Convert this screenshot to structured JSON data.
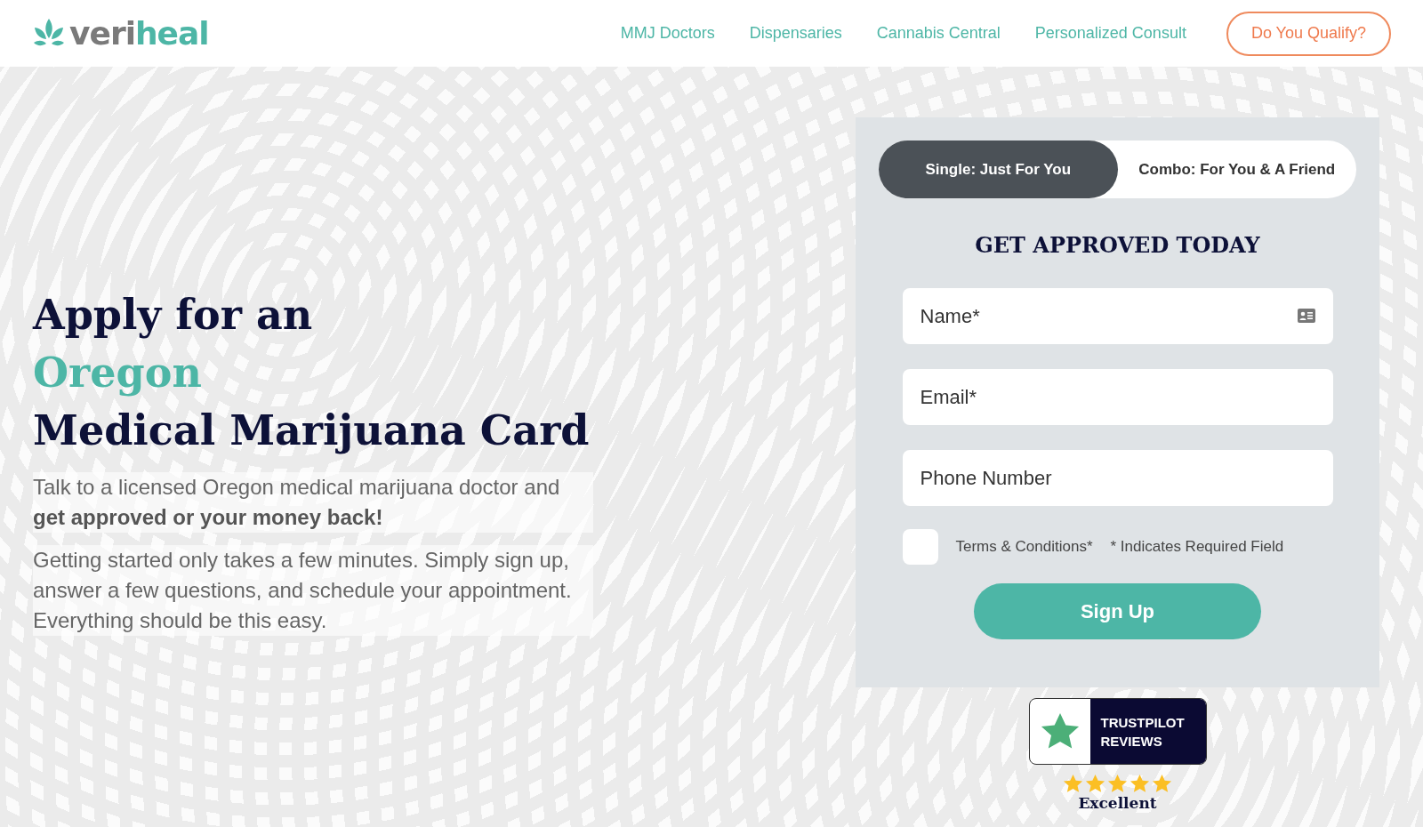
{
  "header": {
    "logo": {
      "part_1": "veri",
      "part_2": "heal"
    },
    "nav": [
      {
        "label": "MMJ Doctors"
      },
      {
        "label": "Dispensaries"
      },
      {
        "label": "Cannabis Central"
      },
      {
        "label": "Personalized Consult"
      }
    ],
    "cta": "Do You Qualify?"
  },
  "hero": {
    "heading": [
      {
        "text": "Apply for an",
        "highlight": false
      },
      {
        "text": "Oregon",
        "highlight": true
      },
      {
        "text": "Medical Marijuana Card",
        "highlight": false
      }
    ],
    "paragraphs": [
      "Talk to a licensed Oregon medical marijuana doctor and **get approved or your money back!**",
      "Getting started only takes a few minutes. Simply sign up, answer a few questions, and schedule your appointment. Everything should be this easy."
    ]
  },
  "form": {
    "tabs": [
      {
        "label": "Single: Just For You",
        "selected": true
      },
      {
        "label": "Combo: For You & A Friend",
        "selected": false
      }
    ],
    "title": "GET APPROVED TODAY",
    "fields": [
      {
        "placeholder": "Name*",
        "kind": "contact"
      },
      {
        "placeholder": "Email*",
        "kind": "plain"
      },
      {
        "placeholder": "Phone Number",
        "kind": "plain"
      }
    ],
    "terms": {
      "label": "Terms & Conditions*",
      "checked": false
    },
    "required_note": "* Indicates Required Field",
    "submit": "Sign Up"
  },
  "trustpilot": {
    "label_1": "TRUSTPILOT",
    "label_2": "REVIEWS",
    "stars": 5,
    "rating": "Excellent"
  }
}
